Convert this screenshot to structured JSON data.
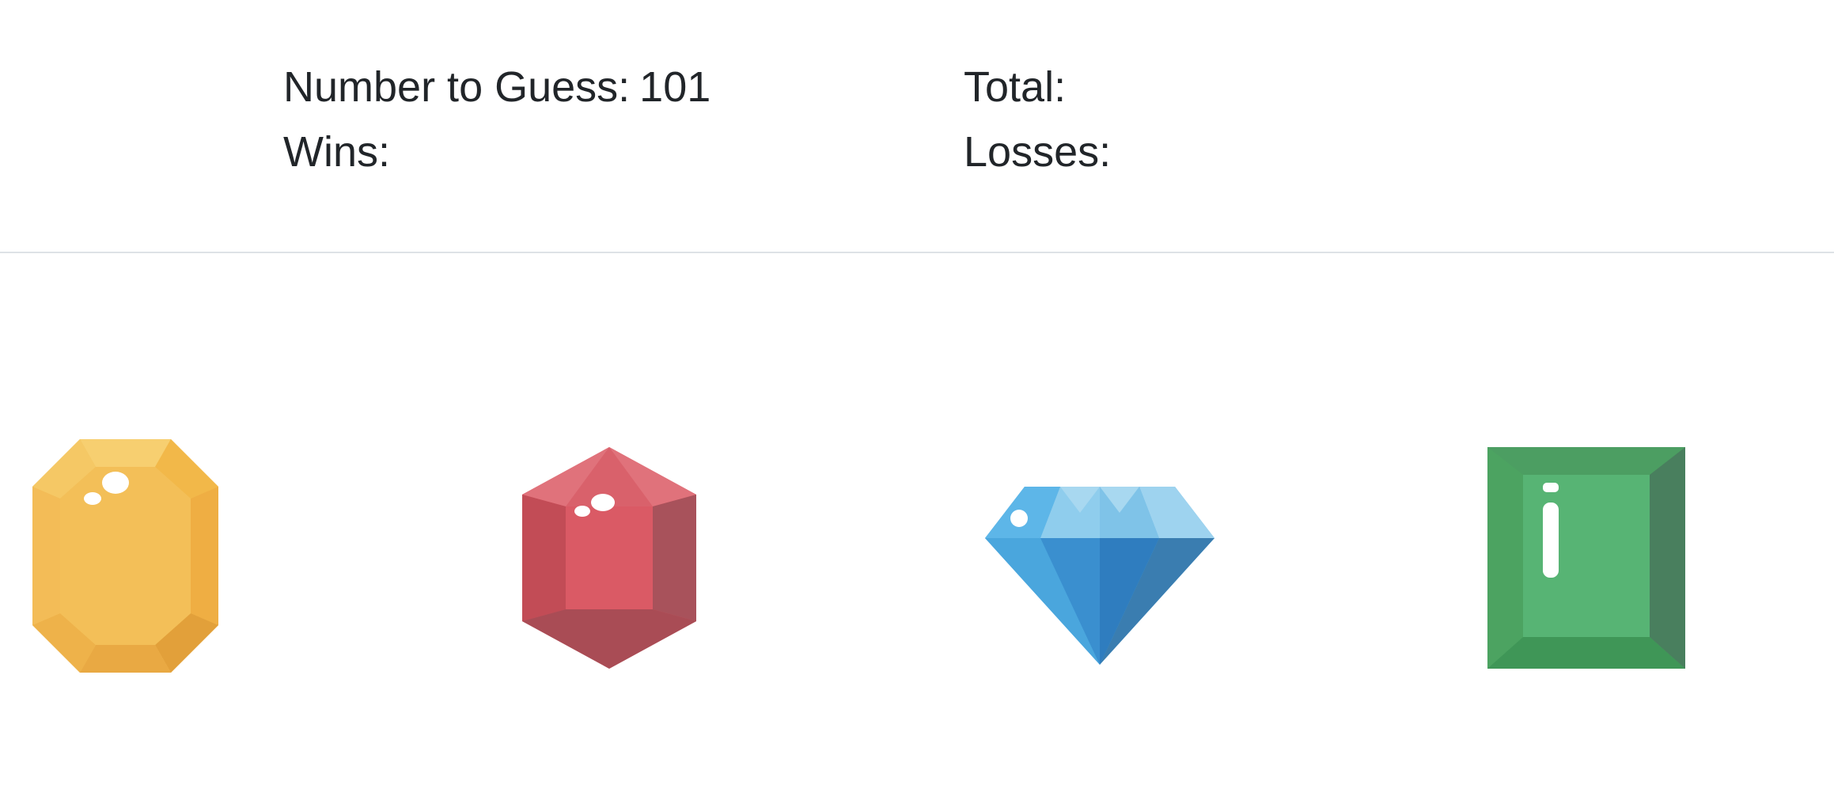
{
  "scoreboard": {
    "target_label": "Number to Guess:",
    "target_value": "101",
    "total_label": "Total:",
    "total_value": "",
    "wins_label": "Wins:",
    "wins_value": "",
    "losses_label": "Losses:",
    "losses_value": ""
  },
  "crystals": [
    {
      "icon": "yellow-gem-icon",
      "color": "#F2BE55"
    },
    {
      "icon": "red-gem-icon",
      "color": "#D95A63"
    },
    {
      "icon": "blue-diamond-icon",
      "color": "#4AA6DD"
    },
    {
      "icon": "green-gem-icon",
      "color": "#55AE6F"
    }
  ],
  "colors": {
    "text": "#212529",
    "divider": "#dee2e6",
    "background": "#ffffff"
  }
}
